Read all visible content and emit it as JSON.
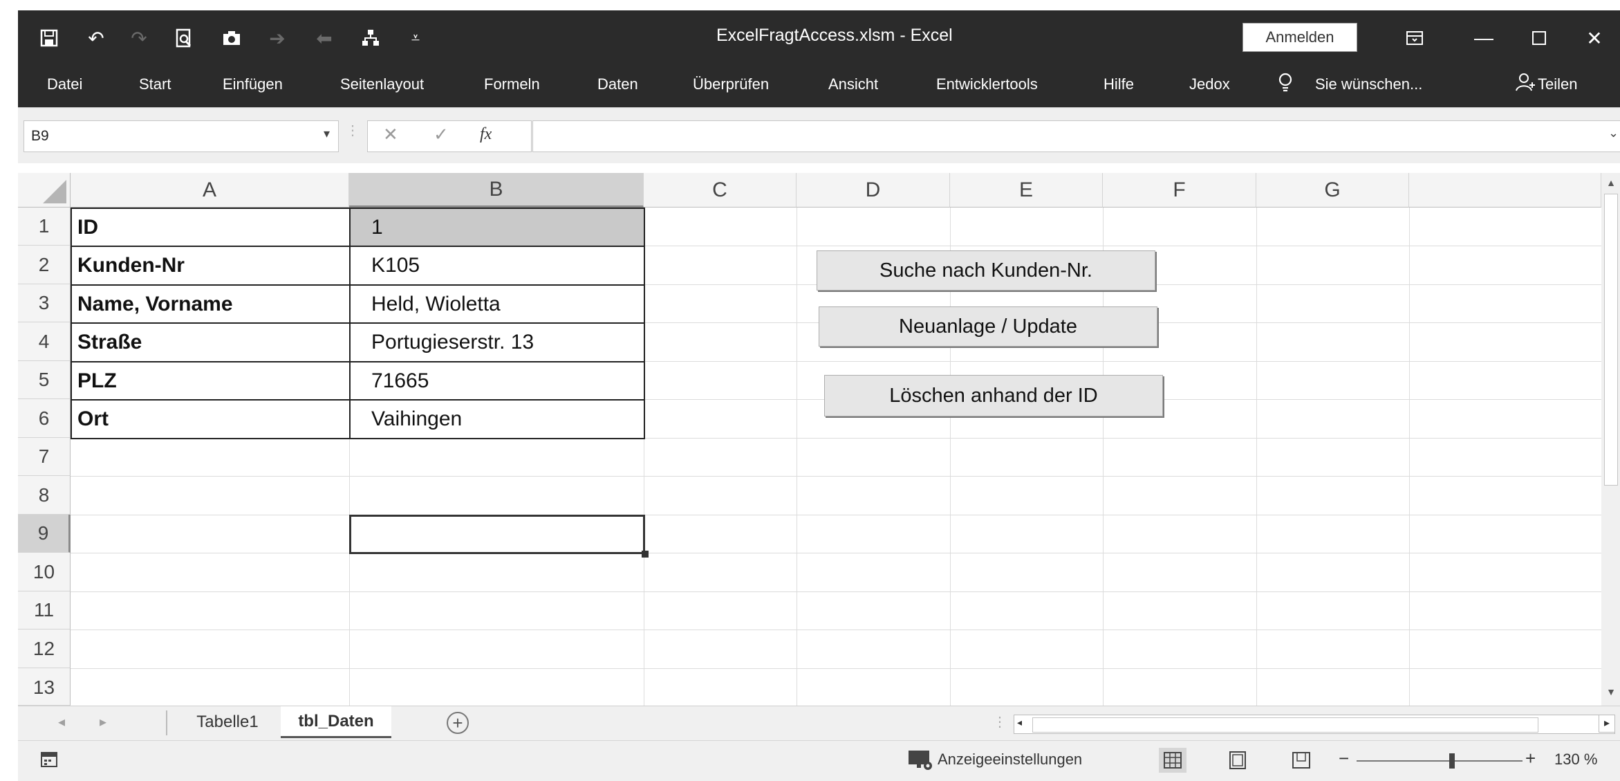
{
  "titlebar": {
    "title": "ExcelFragtAccess.xlsm  -  Excel",
    "signin_label": "Anmelden",
    "icons": [
      "save-icon",
      "undo-icon",
      "redo-icon",
      "print-preview-icon",
      "camera-icon",
      "forward-arrow-icon",
      "back-arrow-icon",
      "sitemap-icon",
      "customize-qat-icon"
    ]
  },
  "ribbon": {
    "tabs": [
      "Datei",
      "Start",
      "Einfügen",
      "Seitenlayout",
      "Formeln",
      "Daten",
      "Überprüfen",
      "Ansicht",
      "Entwicklertools",
      "Hilfe",
      "Jedox"
    ],
    "tell_me": "Sie wünschen...",
    "share": "Teilen"
  },
  "formula_bar": {
    "name_box": "B9",
    "fx_label": "fx",
    "formula": ""
  },
  "grid": {
    "columns": [
      "A",
      "B",
      "C",
      "D",
      "E",
      "F",
      "G"
    ],
    "selected_column": "B",
    "rows": [
      "1",
      "2",
      "3",
      "4",
      "5",
      "6",
      "7",
      "8",
      "9",
      "10",
      "11",
      "12",
      "13"
    ],
    "selected_row": "9",
    "labels": [
      "ID",
      "Kunden-Nr",
      "Name, Vorname",
      "Straße",
      "PLZ",
      "Ort"
    ],
    "values": [
      "1",
      "K105",
      "Held, Wioletta",
      "Portugieserstr. 13",
      "71665",
      "Vaihingen"
    ]
  },
  "buttons": {
    "search": "Suche nach Kunden-Nr.",
    "upsert": "Neuanlage / Update",
    "delete": "Löschen anhand der ID"
  },
  "sheets": {
    "tabs": [
      "Tabelle1",
      "tbl_Daten"
    ],
    "active": "tbl_Daten"
  },
  "statusbar": {
    "display_settings": "Anzeigeeinstellungen",
    "zoom": "130 %"
  }
}
